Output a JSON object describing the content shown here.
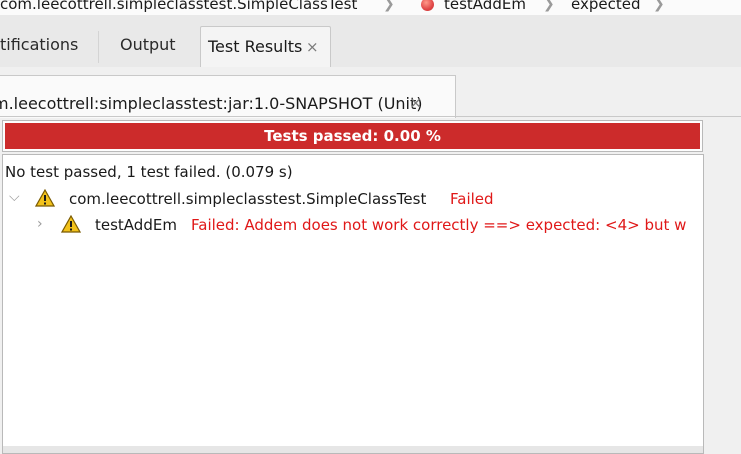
{
  "breadcrumb": {
    "items": [
      {
        "label": "com.leecottrell.simpleclasstest.SimpleClassTest"
      },
      {
        "label": "testAddEm",
        "icon": "error-dot-icon"
      },
      {
        "label": "expected"
      }
    ]
  },
  "tabs": [
    {
      "label": "tifications"
    },
    {
      "label": "Output"
    },
    {
      "label": "Test Results",
      "active": true,
      "closable": true
    }
  ],
  "subtab": {
    "label": "m.leecottrell:simpleclasstest:jar:1.0-SNAPSHOT (Unit)",
    "close": "×"
  },
  "close_glyph": "×",
  "status": {
    "text": "Tests passed: 0.00 %",
    "color": "#cc2b2b"
  },
  "results": {
    "summary": "No test passed, 1 test failed. (0.079 s)",
    "tree": [
      {
        "name": "com.leecottrell.simpleclasstest.SimpleClassTest",
        "status": "Failed",
        "expanded": true,
        "icon": "warning-icon",
        "children": [
          {
            "name": "testAddEm",
            "status": "Failed: Addem does not work correctly ==> expected: <4> but w",
            "expanded": false,
            "icon": "warning-icon"
          }
        ]
      }
    ]
  },
  "colors": {
    "fail_text": "#e01818",
    "warning": "#f2c21b"
  }
}
